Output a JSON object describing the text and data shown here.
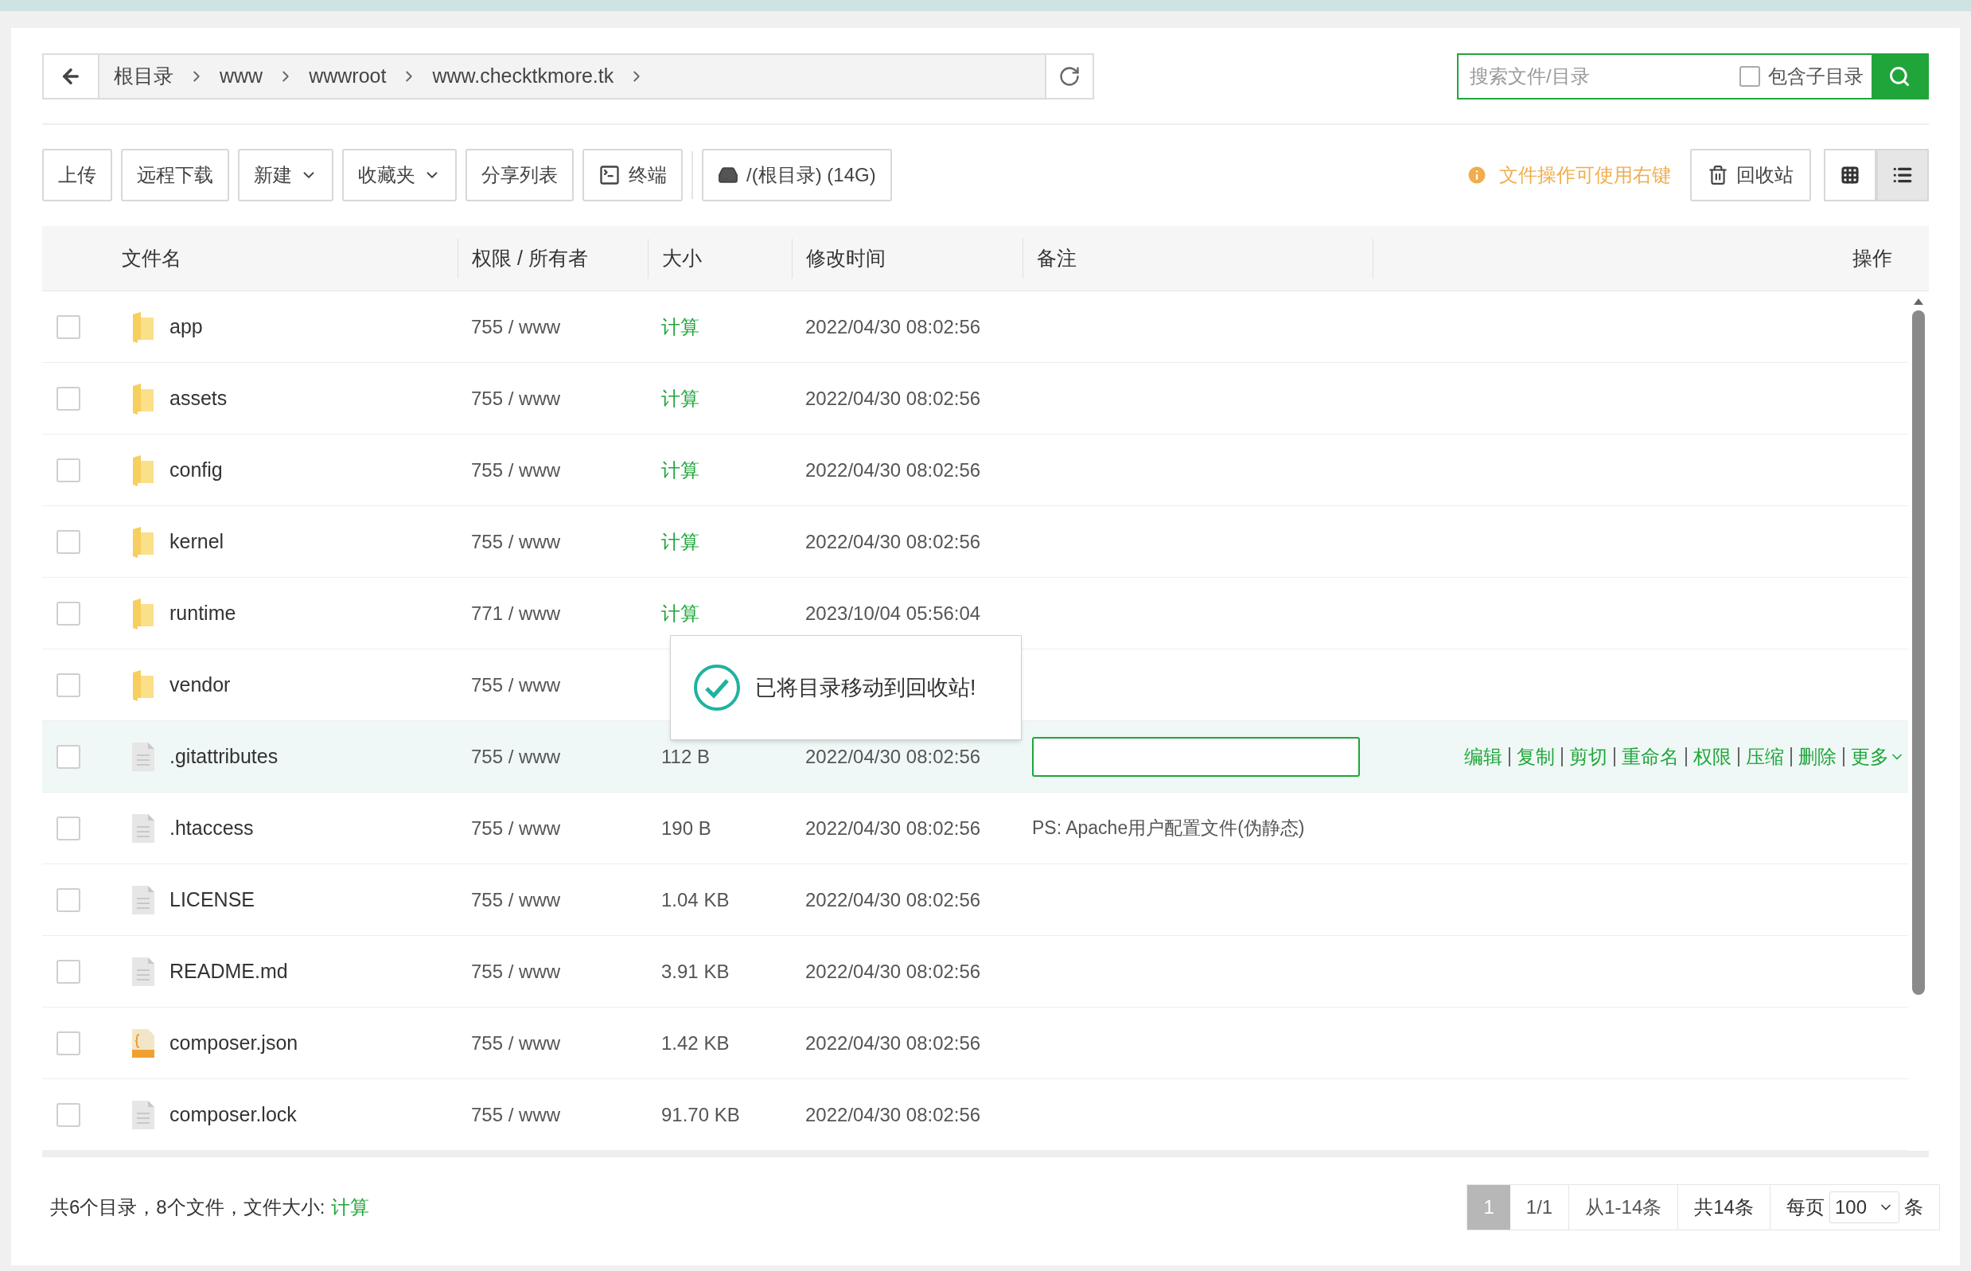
{
  "breadcrumb": [
    "根目录",
    "www",
    "wwwroot",
    "www.checktkmore.tk"
  ],
  "search": {
    "placeholder": "搜索文件/目录",
    "include_subdirs": {
      "label": "包含子目录",
      "checked": false
    }
  },
  "toolbar": [
    {
      "label": "上传",
      "kind": "plain"
    },
    {
      "label": "远程下载",
      "kind": "plain"
    },
    {
      "label": "新建",
      "kind": "dropdown"
    },
    {
      "label": "收藏夹",
      "kind": "dropdown"
    },
    {
      "label": "分享列表",
      "kind": "plain"
    },
    {
      "label": "终端",
      "kind": "terminal"
    },
    {
      "label": "/(根目录) (14G)",
      "kind": "disk"
    }
  ],
  "tip": "文件操作可使用右键",
  "recycle_bin": "回收站",
  "view_modes": [
    {
      "kind": "grid",
      "selected": false
    },
    {
      "kind": "list",
      "selected": true
    }
  ],
  "table": {
    "columns": [
      "文件名",
      "权限 / 所有者",
      "大小",
      "修改时间",
      "备注",
      "操作"
    ],
    "row_actions": [
      "编辑",
      "复制",
      "剪切",
      "重命名",
      "权限",
      "压缩",
      "删除",
      "更多"
    ],
    "rows": [
      {
        "name": "app",
        "kind": "folder",
        "permission": "755 / www",
        "size": "计算",
        "size_link": true,
        "modified": "2022/04/30 08:02:56",
        "selected": false,
        "checked": false
      },
      {
        "name": "assets",
        "kind": "folder",
        "permission": "755 / www",
        "size": "计算",
        "size_link": true,
        "modified": "2022/04/30 08:02:56",
        "selected": false,
        "checked": false
      },
      {
        "name": "config",
        "kind": "folder",
        "permission": "755 / www",
        "size": "计算",
        "size_link": true,
        "modified": "2022/04/30 08:02:56",
        "selected": false,
        "checked": false
      },
      {
        "name": "kernel",
        "kind": "folder",
        "permission": "755 / www",
        "size": "计算",
        "size_link": true,
        "modified": "2022/04/30 08:02:56",
        "selected": false,
        "checked": false
      },
      {
        "name": "runtime",
        "kind": "folder",
        "permission": "771 / www",
        "size": "计算",
        "size_link": true,
        "modified": "2023/10/04 05:56:04",
        "selected": false,
        "checked": false
      },
      {
        "name": "vendor",
        "kind": "folder",
        "permission": "755 / www",
        "selected": false,
        "checked": false
      },
      {
        "name": ".gitattributes",
        "kind": "file",
        "permission": "755 / www",
        "size": "112 B",
        "size_link": false,
        "modified": "2022/04/30 08:02:56",
        "selected": true,
        "checked": false,
        "editing_note": true
      },
      {
        "name": ".htaccess",
        "kind": "file",
        "permission": "755 / www",
        "size": "190 B",
        "size_link": false,
        "modified": "2022/04/30 08:02:56",
        "note": "PS: Apache用户配置文件(伪静态)",
        "selected": false,
        "checked": false
      },
      {
        "name": "LICENSE",
        "kind": "file",
        "permission": "755 / www",
        "size": "1.04 KB",
        "size_link": false,
        "modified": "2022/04/30 08:02:56",
        "selected": false,
        "checked": false
      },
      {
        "name": "README.md",
        "kind": "file",
        "permission": "755 / www",
        "size": "3.91 KB",
        "size_link": false,
        "modified": "2022/04/30 08:02:56",
        "selected": false,
        "checked": false
      },
      {
        "name": "composer.json",
        "kind": "json",
        "permission": "755 / www",
        "size": "1.42 KB",
        "size_link": false,
        "modified": "2022/04/30 08:02:56",
        "selected": false,
        "checked": false
      },
      {
        "name": "composer.lock",
        "kind": "file",
        "permission": "755 / www",
        "size": "91.70 KB",
        "size_link": false,
        "modified": "2022/04/30 08:02:56",
        "selected": false,
        "checked": false
      }
    ]
  },
  "toast": "已将目录移动到回收站!",
  "footer": {
    "summary": "共6个目录，8个文件，文件大小:",
    "summary_link": "计算",
    "pagination": {
      "current": "1",
      "pages": "1/1",
      "range": "从1-14条",
      "total": "共14条",
      "per_page_label": "每页",
      "per_page": "100",
      "unit": "条"
    }
  }
}
